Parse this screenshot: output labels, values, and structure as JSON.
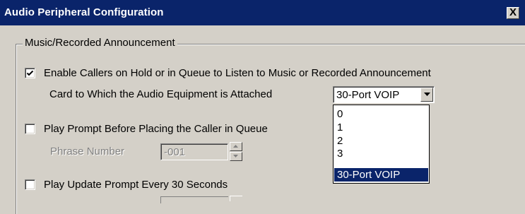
{
  "window": {
    "title": "Audio Peripheral Configuration",
    "close_icon": "close-icon",
    "close_glyph": "X"
  },
  "group": {
    "legend": "Music/Recorded Announcement"
  },
  "enable_music": {
    "label": "Enable Callers on Hold or in Queue to Listen to Music or Recorded Announcement",
    "checked": true
  },
  "card": {
    "label": "Card to Which the Audio Equipment is Attached",
    "selected": "30-Port VOIP",
    "options": [
      "0",
      "1",
      "2",
      "3",
      "30-Port VOIP"
    ],
    "dropdown_open": true
  },
  "play_prompt": {
    "label": "Play Prompt Before Placing the Caller in Queue",
    "checked": false
  },
  "phrase": {
    "label": "Phrase Number",
    "value": "-001",
    "enabled": false
  },
  "update_prompt": {
    "label": "Play Update Prompt Every 30 Seconds",
    "checked": false
  },
  "colors": {
    "title_bar": "#0a246a",
    "face": "#d4d0c8",
    "selection": "#0a246a"
  }
}
